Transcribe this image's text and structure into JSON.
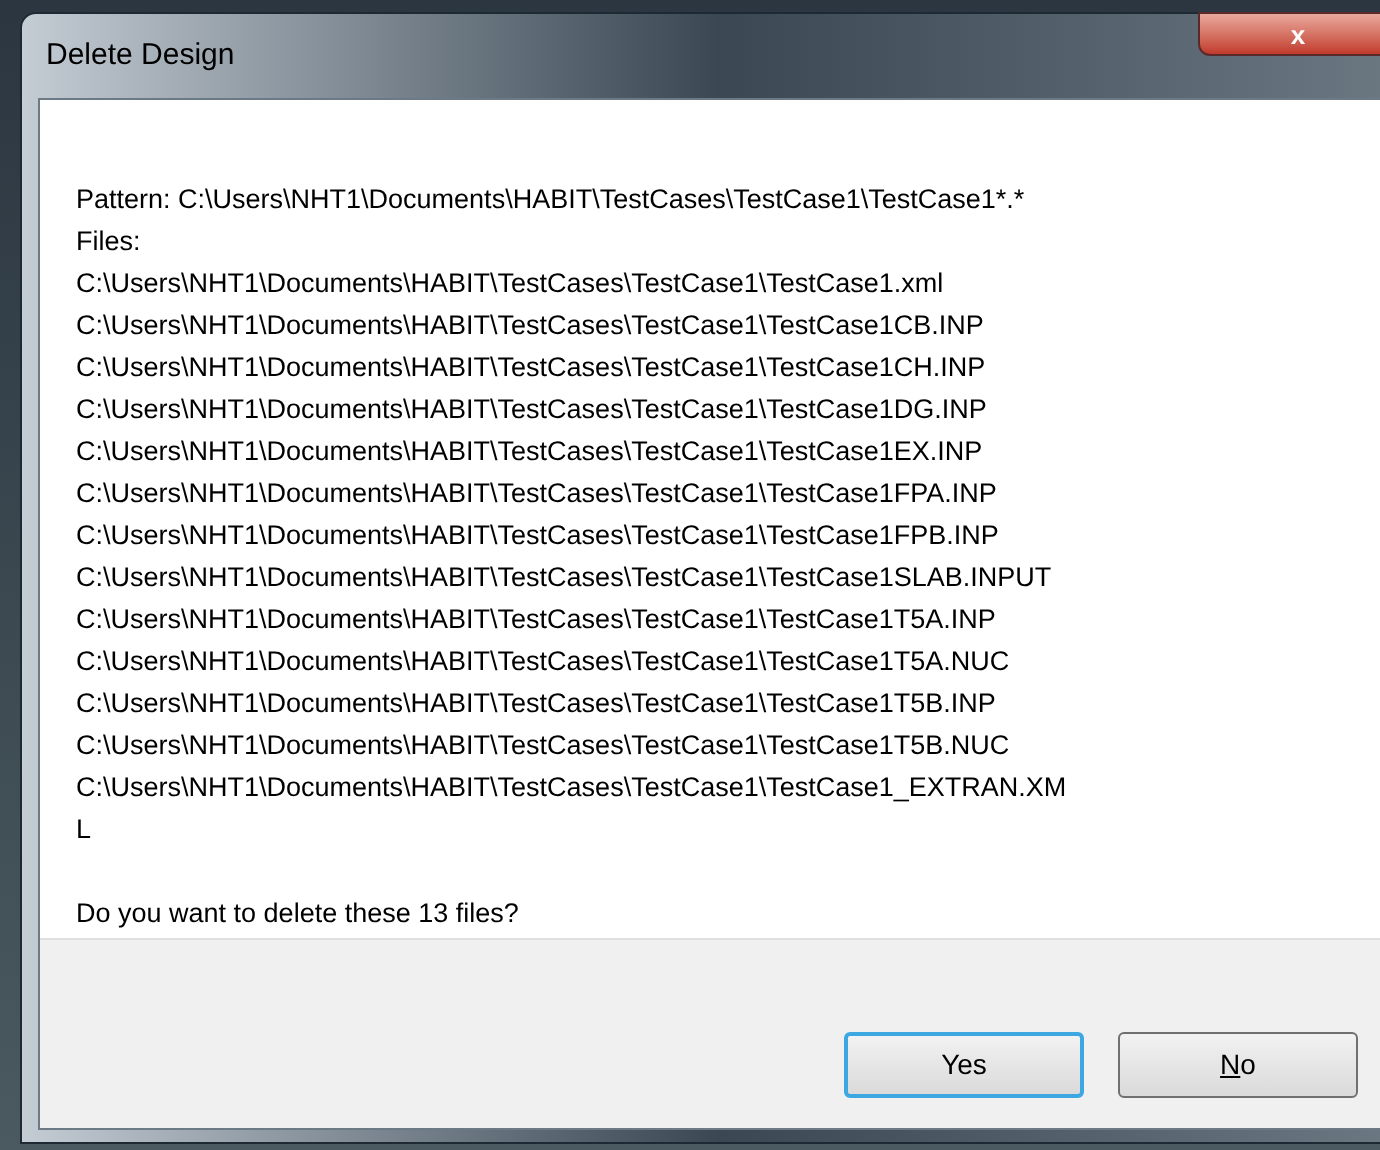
{
  "window": {
    "title": "Delete Design",
    "close_label": "x"
  },
  "message": {
    "pattern": "Pattern: C:\\Users\\NHT1\\Documents\\HABIT\\TestCases\\TestCase1\\TestCase1*.*",
    "files_label": "Files:",
    "files": [
      "C:\\Users\\NHT1\\Documents\\HABIT\\TestCases\\TestCase1\\TestCase1.xml",
      "C:\\Users\\NHT1\\Documents\\HABIT\\TestCases\\TestCase1\\TestCase1CB.INP",
      "C:\\Users\\NHT1\\Documents\\HABIT\\TestCases\\TestCase1\\TestCase1CH.INP",
      "C:\\Users\\NHT1\\Documents\\HABIT\\TestCases\\TestCase1\\TestCase1DG.INP",
      "C:\\Users\\NHT1\\Documents\\HABIT\\TestCases\\TestCase1\\TestCase1EX.INP",
      "C:\\Users\\NHT1\\Documents\\HABIT\\TestCases\\TestCase1\\TestCase1FPA.INP",
      "C:\\Users\\NHT1\\Documents\\HABIT\\TestCases\\TestCase1\\TestCase1FPB.INP",
      "C:\\Users\\NHT1\\Documents\\HABIT\\TestCases\\TestCase1\\TestCase1SLAB.INPUT",
      "C:\\Users\\NHT1\\Documents\\HABIT\\TestCases\\TestCase1\\TestCase1T5A.INP",
      "C:\\Users\\NHT1\\Documents\\HABIT\\TestCases\\TestCase1\\TestCase1T5A.NUC",
      "C:\\Users\\NHT1\\Documents\\HABIT\\TestCases\\TestCase1\\TestCase1T5B.INP",
      "C:\\Users\\NHT1\\Documents\\HABIT\\TestCases\\TestCase1\\TestCase1T5B.NUC",
      "C:\\Users\\NHT1\\Documents\\HABIT\\TestCases\\TestCase1\\TestCase1_EXTRAN.XM",
      "L"
    ],
    "question": "Do you want to delete these 13 files?"
  },
  "buttons": [
    {
      "label": "Yes",
      "default": true,
      "mnemonic_underlined": false
    },
    {
      "label": "No",
      "default": false,
      "mnemonic_underlined": true
    }
  ]
}
